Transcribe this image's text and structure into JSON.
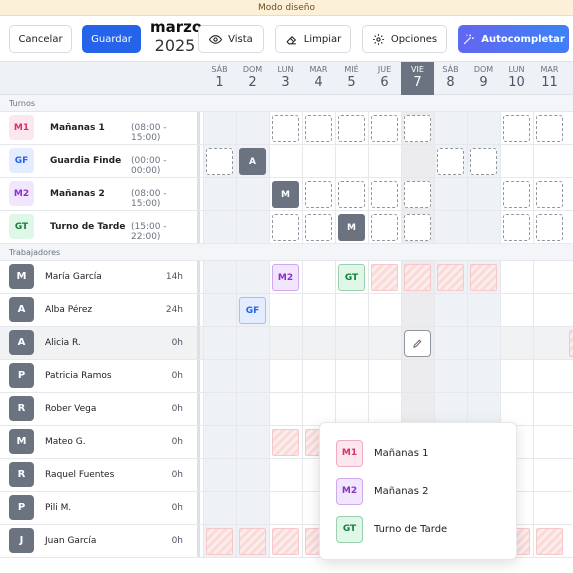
{
  "banner": "Modo diseño",
  "toolbar": {
    "cancel": "Cancelar",
    "save": "Guardar",
    "month": "marzo",
    "year": "2025",
    "vista": "Vista",
    "limpiar": "Limpiar",
    "opciones": "Opciones",
    "autocompletar": "Autocompletar"
  },
  "days": [
    {
      "dow": "SÁB",
      "num": "1"
    },
    {
      "dow": "DOM",
      "num": "2"
    },
    {
      "dow": "LUN",
      "num": "3"
    },
    {
      "dow": "MAR",
      "num": "4"
    },
    {
      "dow": "MIÉ",
      "num": "5"
    },
    {
      "dow": "JUE",
      "num": "6"
    },
    {
      "dow": "VIE",
      "num": "7"
    },
    {
      "dow": "SÁB",
      "num": "8"
    },
    {
      "dow": "DOM",
      "num": "9"
    },
    {
      "dow": "LUN",
      "num": "10"
    },
    {
      "dow": "MAR",
      "num": "11"
    }
  ],
  "sections": {
    "shifts": "Turnos",
    "workers": "Trabajadores"
  },
  "shifts": [
    {
      "code": "M1",
      "name": "Mañanas 1",
      "time": "(08:00 - 15:00)",
      "bg": "#fde7ef",
      "fg": "#d6336c",
      "cells": [
        "",
        "",
        "slot",
        "slot",
        "slot",
        "slot",
        "slot",
        "",
        "",
        "slot",
        "slot"
      ]
    },
    {
      "code": "GF",
      "name": "Guardia Finde",
      "time": "(00:00 - 00:00)",
      "bg": "#e4edff",
      "fg": "#2563eb",
      "cells": [
        "slot",
        "chip:A",
        "",
        "",
        "",
        "",
        "",
        "slot",
        "slot",
        "",
        ""
      ]
    },
    {
      "code": "M2",
      "name": "Mañanas 2",
      "time": "(08:00 - 15:00)",
      "bg": "#f1e6fd",
      "fg": "#8b2fd1",
      "cells": [
        "",
        "",
        "chip:M",
        "slot",
        "slot",
        "slot",
        "slot",
        "",
        "",
        "slot",
        "slot"
      ]
    },
    {
      "code": "GT",
      "name": "Turno de Tarde",
      "time": "(15:00 - 22:00)",
      "bg": "#def7e6",
      "fg": "#15803d",
      "cells": [
        "",
        "",
        "slot",
        "slot",
        "chip:M",
        "slot",
        "slot",
        "",
        "",
        "slot",
        "slot"
      ]
    }
  ],
  "workers": [
    {
      "initial": "M",
      "name": "María García",
      "hours": "14h",
      "cells": [
        "",
        "",
        "M2",
        "",
        "GT",
        "hatch",
        "hatch",
        "hatch",
        "hatch",
        "",
        ""
      ]
    },
    {
      "initial": "A",
      "name": "Alba Pérez",
      "hours": "24h",
      "cells": [
        "",
        "GF",
        "",
        "",
        "",
        "",
        "",
        "",
        "",
        "",
        ""
      ]
    },
    {
      "initial": "A",
      "name": "Alicia R.",
      "hours": "0h",
      "cells": [
        "",
        "",
        "",
        "",
        "",
        "",
        "edit",
        "",
        "",
        "",
        ""
      ]
    },
    {
      "initial": "P",
      "name": "Patricia Ramos",
      "hours": "0h",
      "cells": [
        "",
        "",
        "",
        "",
        "",
        "",
        "",
        "",
        "",
        "",
        ""
      ]
    },
    {
      "initial": "R",
      "name": "Rober Vega",
      "hours": "0h",
      "cells": [
        "",
        "",
        "",
        "",
        "",
        "",
        "",
        "",
        "",
        "",
        ""
      ]
    },
    {
      "initial": "M",
      "name": "Mateo G.",
      "hours": "0h",
      "cells": [
        "",
        "",
        "hatch",
        "hatch",
        "",
        "",
        "",
        "",
        "",
        "",
        ""
      ]
    },
    {
      "initial": "R",
      "name": "Raquel Fuentes",
      "hours": "0h",
      "cells": [
        "",
        "",
        "",
        "",
        "",
        "",
        "",
        "",
        "",
        "",
        ""
      ]
    },
    {
      "initial": "P",
      "name": "Pili M.",
      "hours": "0h",
      "cells": [
        "",
        "",
        "",
        "",
        "",
        "",
        "",
        "",
        "",
        "",
        ""
      ]
    },
    {
      "initial": "J",
      "name": "Juan García",
      "hours": "0h",
      "cells": [
        "hatch",
        "hatch",
        "hatch",
        "hatch",
        "hatch",
        "hatch",
        "hatch",
        "hatch",
        "hatch",
        "hatch",
        "hatch"
      ]
    }
  ],
  "popup": [
    {
      "code": "M1",
      "label": "Mañanas 1",
      "bg": "#fde7ef",
      "fg": "#d6336c"
    },
    {
      "code": "M2",
      "label": "Mañanas 2",
      "bg": "#f1e6fd",
      "fg": "#8b2fd1"
    },
    {
      "code": "GT",
      "label": "Turno de Tarde",
      "bg": "#def7e6",
      "fg": "#15803d"
    }
  ],
  "colors": {
    "accent": "#2563eb",
    "today_header": "#6b7280",
    "avatar": "#6b7280"
  }
}
